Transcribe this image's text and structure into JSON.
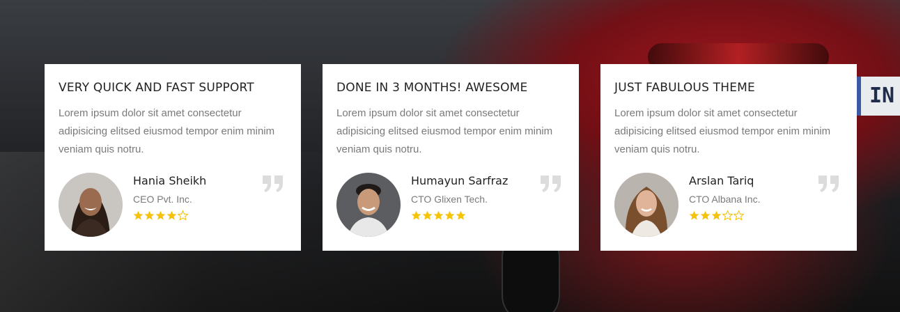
{
  "testimonials": [
    {
      "title": "VERY QUICK AND FAST SUPPORT",
      "text": "Lorem ipsum dolor sit amet consectetur adipisicing elitsed eiusmod tempor enim minim veniam quis notru.",
      "name": "Hania Sheikh",
      "role": "CEO Pvt. Inc.",
      "rating": 4,
      "rating_max": 5
    },
    {
      "title": "DONE IN 3 MONTHS! AWESOME",
      "text": "Lorem ipsum dolor sit amet consectetur adipisicing elitsed eiusmod tempor enim minim veniam quis notru.",
      "name": "Humayun Sarfraz",
      "role": "CTO Glixen Tech.",
      "rating": 5,
      "rating_max": 5
    },
    {
      "title": "JUST FABULOUS THEME",
      "text": "Lorem ipsum dolor sit amet consectetur adipisicing elitsed eiusmod tempor enim minim veniam quis notru.",
      "name": "Arslan Tariq",
      "role": "CTO Albana Inc.",
      "rating": 3,
      "rating_max": 5
    }
  ],
  "icons": {
    "quote": "quote-icon",
    "star": "star-icon"
  },
  "background": {
    "plate_text": "IN"
  },
  "colors": {
    "star": "#f5c30a",
    "quote": "#dcdcdc",
    "card_bg": "#ffffff",
    "title": "#222222",
    "muted": "#7a7a7a"
  }
}
